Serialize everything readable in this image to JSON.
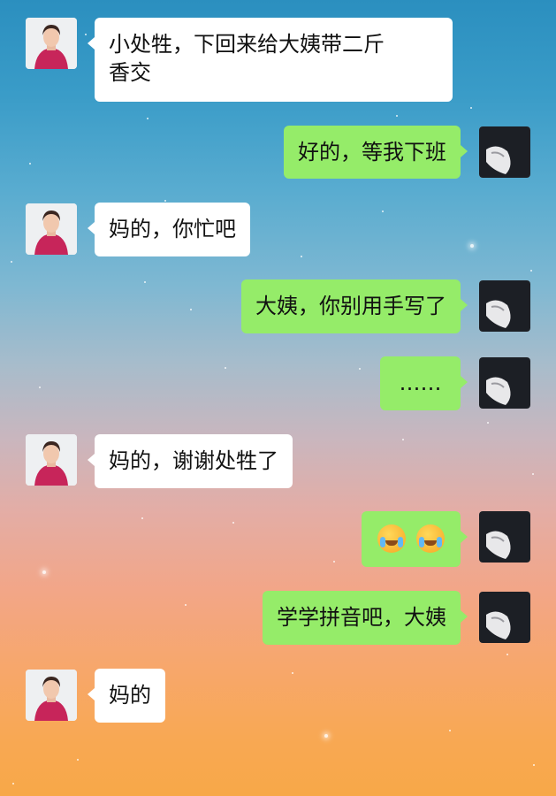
{
  "chat": {
    "messages": [
      {
        "side": "left",
        "text": "小处牲，下回来给大姨带二斤香交"
      },
      {
        "side": "right",
        "text": "好的，等我下班"
      },
      {
        "side": "left",
        "text": "妈的，你忙吧"
      },
      {
        "side": "right",
        "text": "大姨，你别用手写了"
      },
      {
        "side": "right",
        "text": "……"
      },
      {
        "side": "left",
        "text": "妈的，谢谢处牲了"
      },
      {
        "side": "right",
        "emoji": [
          "laughing-crying-emoji",
          "laughing-crying-emoji"
        ]
      },
      {
        "side": "right",
        "text": "学学拼音吧，大姨"
      },
      {
        "side": "left",
        "text": "妈的"
      }
    ],
    "line1": "小处牲，下回来给大姨带二斤",
    "line2": "香交"
  },
  "colors": {
    "sent_bubble": "#95ec69",
    "received_bubble": "#ffffff",
    "aunt_coat": "#c7255a"
  }
}
